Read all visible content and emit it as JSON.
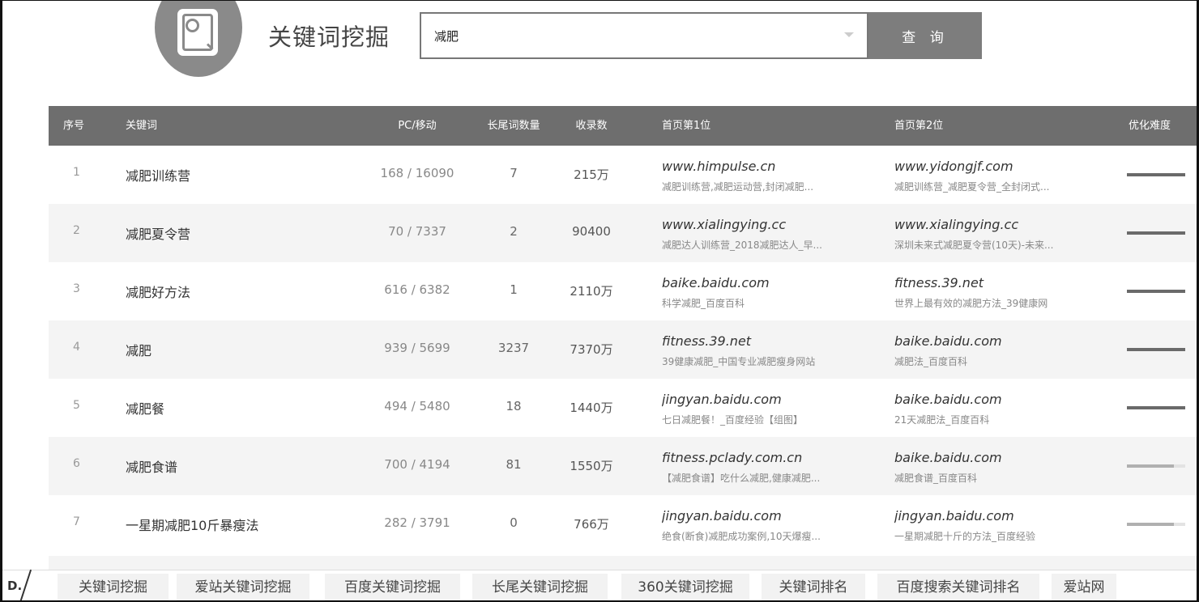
{
  "header": {
    "title": "关键词挖掘",
    "search_value": "减肥",
    "search_button": "查 询",
    "icon": "magnifier-document-icon"
  },
  "table": {
    "columns": [
      "序号",
      "关键词",
      "PC/移动",
      "长尾词数量",
      "收录数",
      "首页第1位",
      "首页第2位",
      "优化难度"
    ],
    "rows": [
      {
        "idx": "1",
        "keyword": "减肥训练营",
        "pc_mobile": "168 / 16090",
        "long_tail": "7",
        "indexed": "215万",
        "first_site": "www.himpulse.cn",
        "first_desc": "减肥训练营,减肥运动营,封闭减肥...",
        "second_site": "www.yidongjf.com",
        "second_desc": "减肥训练营_减肥夏令营_全封闭式...",
        "difficulty": 1.0
      },
      {
        "idx": "2",
        "keyword": "减肥夏令营",
        "pc_mobile": "70 / 7337",
        "long_tail": "2",
        "indexed": "90400",
        "first_site": "www.xialingying.cc",
        "first_desc": "减肥达人训练营_2018减肥达人_早...",
        "second_site": "www.xialingying.cc",
        "second_desc": "深圳未来式减肥夏令营(10天)-未来...",
        "difficulty": 1.0
      },
      {
        "idx": "3",
        "keyword": "减肥好方法",
        "pc_mobile": "616 / 6382",
        "long_tail": "1",
        "indexed": "2110万",
        "first_site": "baike.baidu.com",
        "first_desc": "科学减肥_百度百科",
        "second_site": "fitness.39.net",
        "second_desc": "世界上最有效的减肥方法_39健康网",
        "difficulty": 1.0
      },
      {
        "idx": "4",
        "keyword": "减肥",
        "pc_mobile": "939 / 5699",
        "long_tail": "3237",
        "indexed": "7370万",
        "first_site": "fitness.39.net",
        "first_desc": "39健康减肥_中国专业减肥瘦身网站",
        "second_site": "baike.baidu.com",
        "second_desc": "减肥法_百度百科",
        "difficulty": 1.0
      },
      {
        "idx": "5",
        "keyword": "减肥餐",
        "pc_mobile": "494 / 5480",
        "long_tail": "18",
        "indexed": "1440万",
        "first_site": "jingyan.baidu.com",
        "first_desc": "七日减肥餐！_百度经验【组图】",
        "second_site": "baike.baidu.com",
        "second_desc": "21天减肥法_百度百科",
        "difficulty": 1.0
      },
      {
        "idx": "6",
        "keyword": "减肥食谱",
        "pc_mobile": "700 / 4194",
        "long_tail": "81",
        "indexed": "1550万",
        "first_site": "fitness.pclady.com.cn",
        "first_desc": "【减肥食谱】吃什么减肥,健康减肥...",
        "second_site": "baike.baidu.com",
        "second_desc": "减肥食谱_百度百科",
        "difficulty": 0.8
      },
      {
        "idx": "7",
        "keyword": "一星期减肥10斤暴瘦法",
        "pc_mobile": "282 / 3791",
        "long_tail": "0",
        "indexed": "766万",
        "first_site": "jingyan.baidu.com",
        "first_desc": "绝食(断食)减肥成功案例,10天爆瘦...",
        "second_site": "jingyan.baidu.com",
        "second_desc": "一星期减肥十斤的方法_百度经验",
        "difficulty": 0.8
      }
    ]
  },
  "footer": {
    "tag": "D.",
    "links": [
      "关键词挖掘",
      "爱站关键词挖掘",
      "百度关键词挖掘",
      "长尾关键词挖掘",
      "360关键词挖掘",
      "关键词排名",
      "百度搜索关键词排名",
      "爱站网"
    ]
  },
  "colors": {
    "header_bg": "#6e6e6e",
    "button_bg": "#7d7d7d",
    "logo_bg": "#8a8a8a",
    "row_alt": "#f4f4f4"
  }
}
